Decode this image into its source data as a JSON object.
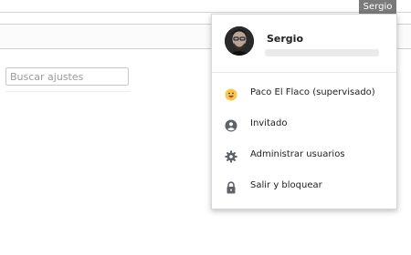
{
  "settings": {
    "search_placeholder": "Buscar ajustes"
  },
  "profile_chip": {
    "label": "Sergio"
  },
  "menu": {
    "user": {
      "name": "Sergio"
    },
    "items": [
      {
        "label": "Paco El Flaco (supervisado)",
        "icon": "supervised-user-emoji-icon"
      },
      {
        "label": "Invitado",
        "icon": "guest-person-icon"
      },
      {
        "label": "Administrar usuarios",
        "icon": "gear-icon"
      },
      {
        "label": "Salir y bloquear",
        "icon": "lock-icon"
      }
    ]
  }
}
